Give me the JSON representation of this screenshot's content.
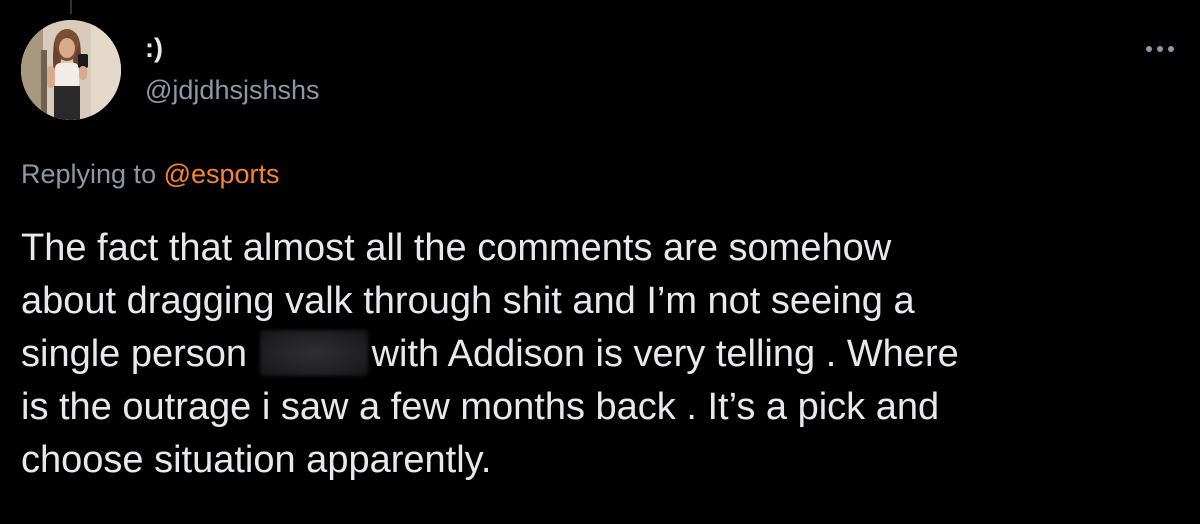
{
  "author": {
    "display_name": ":)",
    "handle": "@jdjdhsjshshs",
    "avatar": "avatar-photo"
  },
  "reply": {
    "prefix": "Replying to ",
    "mention": "@esports"
  },
  "tweet": {
    "line1": "The fact that almost all the comments are somehow",
    "line2": "about dragging valk through shit and I’m not seeing a",
    "line3_before": "single person ",
    "line3_after": "with Addison is very telling . Where",
    "line4": "is the outrage i saw a few months back . It’s a pick and",
    "line5": "choose situation apparently."
  },
  "icons": {
    "more": "more-dots-icon"
  },
  "colors": {
    "background": "#000000",
    "text_primary": "#e7e9ea",
    "text_secondary": "#8b98a5",
    "mention": "#f4852f"
  }
}
